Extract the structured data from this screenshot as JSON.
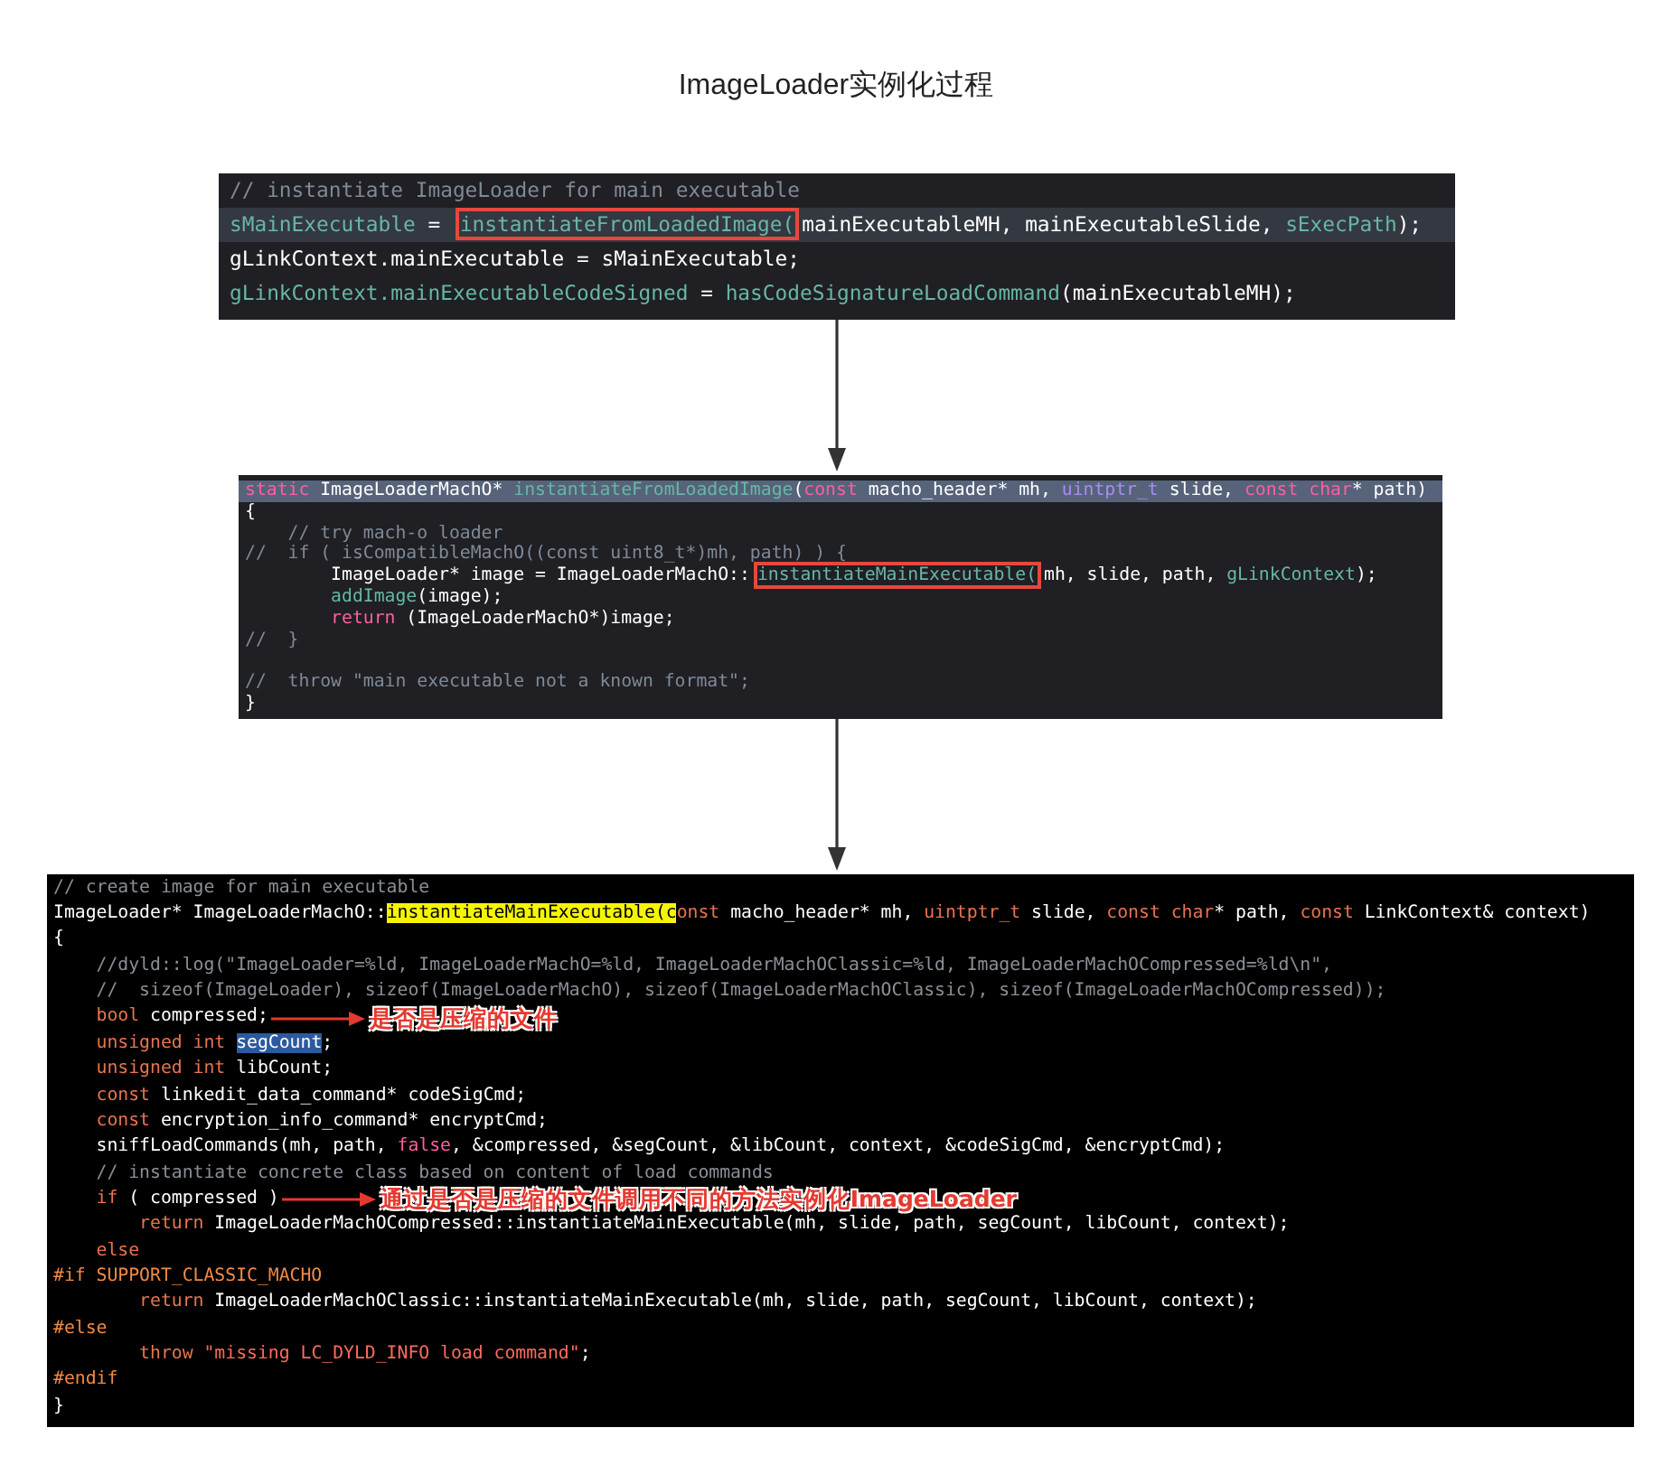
{
  "title": "ImageLoader实例化过程",
  "panels": [
    {
      "kind": "xcode",
      "lines": [
        {
          "highlighted": false,
          "tokens": [
            {
              "text": "// instantiate ImageLoader for main executable",
              "kind": "comment"
            }
          ]
        },
        {
          "highlighted": true,
          "tokens": [
            {
              "text": "sMainExecutable",
              "kind": "func"
            },
            {
              "text": " = ",
              "kind": "plain"
            },
            {
              "text": "instantiateFromLoadedImage(",
              "kind": "func",
              "boxed": true
            },
            {
              "text": "mainExecutableMH, mainExecutableSlide, ",
              "kind": "plain"
            },
            {
              "text": "sExecPath",
              "kind": "func"
            },
            {
              "text": ");",
              "kind": "plain"
            }
          ]
        },
        {
          "highlighted": false,
          "tokens": [
            {
              "text": "gLinkContext.mainExecutable = sMainExecutable;",
              "kind": "plain"
            }
          ]
        },
        {
          "highlighted": false,
          "tokens": [
            {
              "text": "gLinkContext.",
              "kind": "func"
            },
            {
              "text": "mainExecutableCodeSigned",
              "kind": "func"
            },
            {
              "text": " = ",
              "kind": "plain"
            },
            {
              "text": "hasCodeSignatureLoadCommand",
              "kind": "func"
            },
            {
              "text": "(mainExecutableMH);",
              "kind": "plain"
            }
          ]
        }
      ]
    },
    {
      "kind": "xcode-small",
      "lines": [
        {
          "highlighted": true,
          "tokens": [
            {
              "text": "static",
              "kind": "keyword"
            },
            {
              "text": " ImageLoaderMachO* ",
              "kind": "plain"
            },
            {
              "text": "instantiateFromLoadedImage",
              "kind": "func"
            },
            {
              "text": "(",
              "kind": "plain"
            },
            {
              "text": "const",
              "kind": "keyword"
            },
            {
              "text": " macho_header* mh, ",
              "kind": "plain"
            },
            {
              "text": "uintptr_t",
              "kind": "type"
            },
            {
              "text": " slide, ",
              "kind": "plain"
            },
            {
              "text": "const char",
              "kind": "keyword"
            },
            {
              "text": "* path)",
              "kind": "plain"
            }
          ]
        },
        {
          "highlighted": false,
          "tokens": [
            {
              "text": "{",
              "kind": "plain"
            }
          ]
        },
        {
          "highlighted": false,
          "tokens": [
            {
              "text": "    // try mach-o loader",
              "kind": "comment"
            }
          ]
        },
        {
          "highlighted": false,
          "tokens": [
            {
              "text": "//  if ( isCompatibleMachO((const uint8_t*)mh, path) ) {",
              "kind": "comment"
            }
          ]
        },
        {
          "highlighted": false,
          "tokens": [
            {
              "text": "        ImageLoader* image = ImageLoaderMachO::",
              "kind": "plain"
            },
            {
              "text": "instantiateMainExecutable(",
              "kind": "func",
              "boxed": true
            },
            {
              "text": "mh, slide, path, ",
              "kind": "plain"
            },
            {
              "text": "gLinkContext",
              "kind": "func"
            },
            {
              "text": ");",
              "kind": "plain"
            }
          ]
        },
        {
          "highlighted": false,
          "tokens": [
            {
              "text": "        addImage",
              "kind": "func"
            },
            {
              "text": "(image);",
              "kind": "plain"
            }
          ]
        },
        {
          "highlighted": false,
          "tokens": [
            {
              "text": "        return",
              "kind": "keyword"
            },
            {
              "text": " (ImageLoaderMachO*)image;",
              "kind": "plain"
            }
          ]
        },
        {
          "highlighted": false,
          "tokens": [
            {
              "text": "//  }",
              "kind": "comment"
            }
          ]
        },
        {
          "highlighted": false
        },
        {
          "highlighted": false,
          "tokens": [
            {
              "text": "//  throw \"main executable not a known format\";",
              "kind": "comment"
            }
          ]
        },
        {
          "highlighted": false,
          "tokens": [
            {
              "text": "}",
              "kind": "plain"
            }
          ]
        }
      ]
    },
    {
      "kind": "black",
      "lines": [
        {
          "highlighted": false,
          "tokens": [
            {
              "text": "// create image for main executable",
              "kind": "comment"
            }
          ]
        },
        {
          "highlighted": false,
          "tokens": [
            {
              "text": "ImageLoader* ImageLoaderMachO::",
              "kind": "plain"
            },
            {
              "text": "instantiateMainExecutable(c",
              "kind": "marked"
            },
            {
              "text": "onst",
              "kind": "keyword-alt"
            },
            {
              "text": " macho_header* mh, ",
              "kind": "plain"
            },
            {
              "text": "uintptr_t",
              "kind": "keyword-alt"
            },
            {
              "text": " slide, ",
              "kind": "plain"
            },
            {
              "text": "const char",
              "kind": "keyword-alt"
            },
            {
              "text": "* path, ",
              "kind": "plain"
            },
            {
              "text": "const",
              "kind": "keyword-alt"
            },
            {
              "text": " LinkContext& context)",
              "kind": "plain"
            }
          ]
        },
        {
          "highlighted": false,
          "tokens": [
            {
              "text": "{",
              "kind": "plain"
            }
          ]
        },
        {
          "highlighted": false,
          "tokens": [
            {
              "text": "    //dyld::log(\"ImageLoader=%ld, ImageLoaderMachO=%ld, ImageLoaderMachOClassic=%ld, ImageLoaderMachOCompressed=%ld\\n\",",
              "kind": "comment"
            }
          ]
        },
        {
          "highlighted": false,
          "tokens": [
            {
              "text": "    //  sizeof(ImageLoader), sizeof(ImageLoaderMachO), sizeof(ImageLoaderMachOClassic), sizeof(ImageLoaderMachOCompressed));",
              "kind": "comment"
            }
          ]
        },
        {
          "highlighted": false,
          "tokens": [
            {
              "text": "    bool",
              "kind": "keyword-alt"
            },
            {
              "text": " compressed;",
              "kind": "plain"
            }
          ],
          "note": "是否是压缩的文件"
        },
        {
          "highlighted": false,
          "tokens": [
            {
              "text": "    unsigned int ",
              "kind": "keyword-alt"
            },
            {
              "text": "segCount",
              "kind": "selection"
            },
            {
              "text": ";",
              "kind": "plain"
            }
          ]
        },
        {
          "highlighted": false,
          "tokens": [
            {
              "text": "    unsigned int",
              "kind": "keyword-alt"
            },
            {
              "text": " libCount;",
              "kind": "plain"
            }
          ]
        },
        {
          "highlighted": false,
          "tokens": [
            {
              "text": "    const",
              "kind": "keyword-alt"
            },
            {
              "text": " linkedit_data_command* codeSigCmd;",
              "kind": "plain"
            }
          ]
        },
        {
          "highlighted": false,
          "tokens": [
            {
              "text": "    const",
              "kind": "keyword-alt"
            },
            {
              "text": " encryption_info_command* encryptCmd;",
              "kind": "plain"
            }
          ]
        },
        {
          "highlighted": false,
          "tokens": [
            {
              "text": "    sniffLoadCommands(mh, path, ",
              "kind": "plain"
            },
            {
              "text": "false",
              "kind": "keyword"
            },
            {
              "text": ", &compressed, &segCount, &libCount, context, &codeSigCmd, &encryptCmd);",
              "kind": "plain"
            }
          ]
        },
        {
          "highlighted": false,
          "tokens": [
            {
              "text": "    // instantiate concrete class based on content of load commands",
              "kind": "comment"
            }
          ]
        },
        {
          "highlighted": false,
          "tokens": [
            {
              "text": "    if",
              "kind": "keyword-alt"
            },
            {
              "text": " ( compressed )",
              "kind": "plain"
            }
          ],
          "note": "通过是否是压缩的文件调用不同的方法实例化ImageLoader"
        },
        {
          "highlighted": false,
          "tokens": [
            {
              "text": "        return",
              "kind": "keyword-alt"
            },
            {
              "text": " ImageLoaderMachOCompressed::instantiateMainExecutable(mh, slide, path, segCount, libCount, context);",
              "kind": "plain"
            }
          ]
        },
        {
          "highlighted": false,
          "tokens": [
            {
              "text": "    else",
              "kind": "keyword-alt"
            }
          ]
        },
        {
          "highlighted": false,
          "tokens": [
            {
              "text": "#if SUPPORT_CLASSIC_MACHO",
              "kind": "directive"
            }
          ]
        },
        {
          "highlighted": false,
          "tokens": [
            {
              "text": "        return",
              "kind": "keyword-alt"
            },
            {
              "text": " ImageLoaderMachOClassic::instantiateMainExecutable(mh, slide, path, segCount, libCount, context);",
              "kind": "plain"
            }
          ]
        },
        {
          "highlighted": false,
          "tokens": [
            {
              "text": "#else",
              "kind": "directive"
            }
          ]
        },
        {
          "highlighted": false,
          "tokens": [
            {
              "text": "        throw",
              "kind": "keyword-alt"
            },
            {
              "text": " \"missing LC_DYLD_INFO load command\"",
              "kind": "string"
            },
            {
              "text": ";",
              "kind": "plain"
            }
          ]
        },
        {
          "highlighted": false,
          "tokens": [
            {
              "text": "#endif",
              "kind": "directive"
            }
          ]
        },
        {
          "highlighted": false,
          "tokens": [
            {
              "text": "}",
              "kind": "plain"
            }
          ]
        }
      ]
    }
  ]
}
